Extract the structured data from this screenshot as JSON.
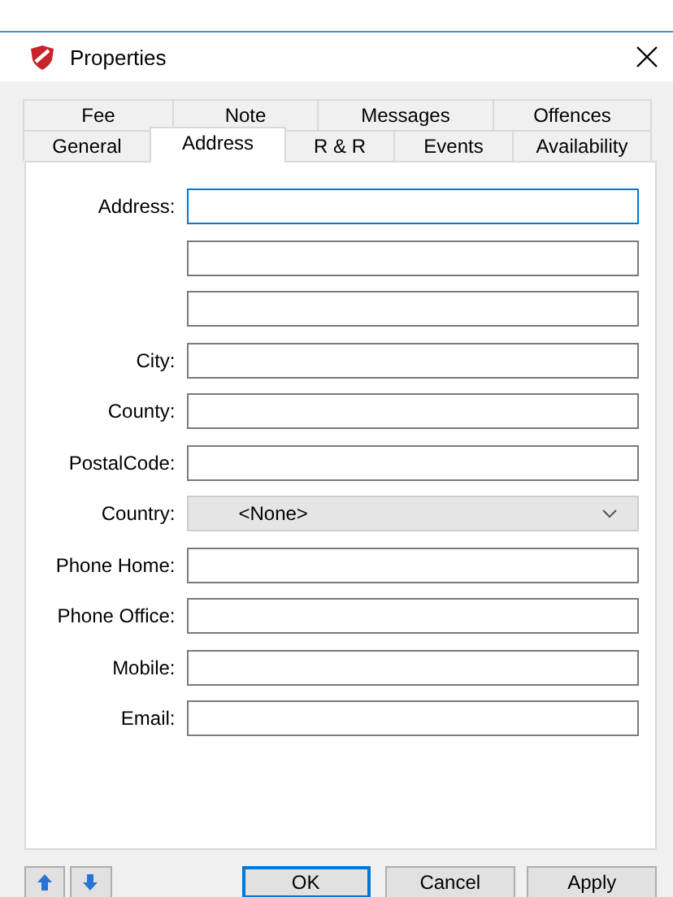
{
  "window": {
    "title": "Properties"
  },
  "tab_rows": [
    [
      {
        "label": "Fee",
        "selected": false
      },
      {
        "label": "Note",
        "selected": false
      },
      {
        "label": "Messages",
        "selected": false
      },
      {
        "label": "Offences",
        "selected": false
      }
    ],
    [
      {
        "label": "General",
        "selected": false
      },
      {
        "label": "Address",
        "selected": true
      },
      {
        "label": "R & R",
        "selected": false
      },
      {
        "label": "Events",
        "selected": false
      },
      {
        "label": "Availability",
        "selected": false
      }
    ]
  ],
  "fields": [
    {
      "kind": "input",
      "label": "Address:",
      "focused": true
    },
    {
      "kind": "input",
      "focused": false
    },
    {
      "kind": "input",
      "focused": false
    },
    {
      "kind": "input",
      "label": "City:",
      "focused": false
    },
    {
      "kind": "input",
      "label": "County:",
      "focused": false
    },
    {
      "kind": "input",
      "label": "PostalCode:",
      "focused": false
    },
    {
      "kind": "dropdown",
      "label": "Country:",
      "value": "<None>",
      "focused": false
    },
    {
      "kind": "input",
      "label": "Phone Home:",
      "focused": false
    },
    {
      "kind": "input",
      "label": "Phone Office:",
      "focused": false
    },
    {
      "kind": "input",
      "label": "Mobile:",
      "focused": false
    },
    {
      "kind": "input",
      "label": "Email:",
      "focused": false
    }
  ],
  "nav_buttons": [
    {
      "kind": "up"
    },
    {
      "kind": "down"
    }
  ],
  "buttons": [
    {
      "label": "OK",
      "default": true
    },
    {
      "label": "Cancel",
      "default": false
    },
    {
      "label": "Apply",
      "default": false
    }
  ]
}
